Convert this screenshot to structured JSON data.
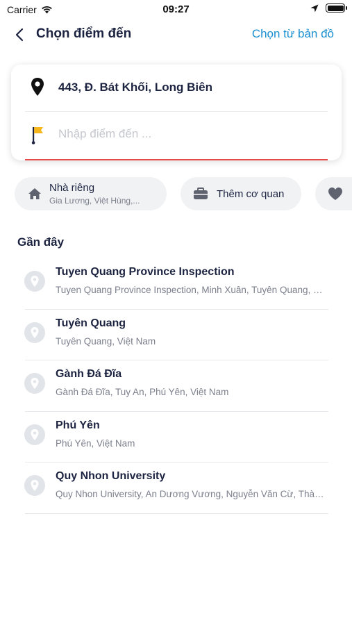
{
  "status_bar": {
    "carrier": "Carrier",
    "time": "09:27"
  },
  "nav": {
    "title": "Chọn điểm đến",
    "map_pick": "Chọn từ bản đồ"
  },
  "route": {
    "origin": "443, Đ. Bát Khối, Long Biên",
    "destination_value": "",
    "destination_placeholder": "Nhập điểm đến ..."
  },
  "chips": {
    "home": {
      "title": "Nhà riêng",
      "subtitle": "Gia Lương, Việt Hùng,..."
    },
    "work": {
      "title": "Thêm cơ quan"
    }
  },
  "recent": {
    "title": "Gần đây",
    "items": [
      {
        "name": "Tuyen Quang Province Inspection",
        "address": "Tuyen Quang Province Inspection, Minh Xuân, Tuyên Quang, Việt Nam"
      },
      {
        "name": "Tuyên Quang",
        "address": "Tuyên Quang, Việt Nam"
      },
      {
        "name": "Gành Đá Đĩa",
        "address": "Gành Đá Đĩa, Tuy An, Phú Yên, Việt Nam"
      },
      {
        "name": "Phú Yên",
        "address": "Phú Yên, Việt Nam"
      },
      {
        "name": "Quy Nhon University",
        "address": "Quy Nhon University, An Dương Vương, Nguyễn Văn Cừ, Thành phố Quy Nhơn"
      }
    ]
  },
  "colors": {
    "accent_blue": "#1a8fcf",
    "title_navy": "#1c2340",
    "flag_yellow": "#f5b71c",
    "underline_red": "#e84a4a",
    "chip_bg": "#f1f2f4"
  },
  "icons": {
    "back": "chevron-left-icon",
    "origin": "location-pin-icon",
    "destination": "flag-icon",
    "home": "home-icon",
    "work": "briefcase-icon",
    "favorite": "heart-icon",
    "recent": "map-pin-icon",
    "wifi": "wifi-icon",
    "location": "location-arrow-icon",
    "battery": "battery-icon"
  }
}
